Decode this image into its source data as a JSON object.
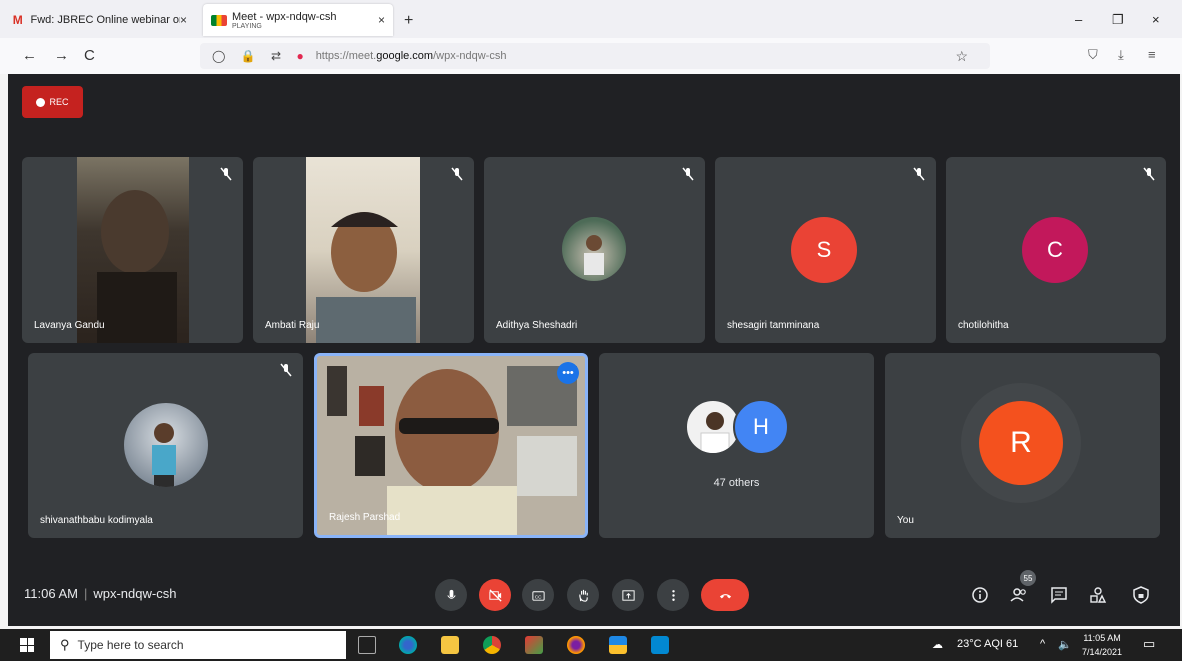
{
  "browser": {
    "tabs": [
      {
        "title": "Fwd: JBREC Online webinar on",
        "close": "×"
      },
      {
        "title": "Meet - wpx-ndqw-csh",
        "subtitle": "PLAYING",
        "close": "×"
      }
    ],
    "new_tab": "+",
    "window_controls": {
      "minimize": "–",
      "restore": "❐",
      "close": "×"
    },
    "nav": {
      "back": "←",
      "forward": "→",
      "reload": "C"
    },
    "url": {
      "prefix": "https://meet.",
      "domain": "google.com",
      "path": "/wpx-ndqw-csh"
    }
  },
  "meet": {
    "rec_label": "REC",
    "tiles_row1": [
      {
        "name": "Lavanya Gandu",
        "muted": true
      },
      {
        "name": "Ambati Raju",
        "muted": true
      },
      {
        "name": "Adithya Sheshadri",
        "muted": true
      },
      {
        "name": "shesagiri tamminana",
        "muted": true,
        "initial": "S",
        "color": "#ea4335"
      },
      {
        "name": "chotilohitha",
        "muted": true,
        "initial": "C",
        "color": "#c2185b"
      }
    ],
    "tiles_row2": [
      {
        "name": "shivanathbabu kodimyala",
        "muted": true
      },
      {
        "name": "Rajesh Parshad"
      },
      {
        "others_label": "47 others",
        "initial": "H",
        "color": "#4285f4"
      },
      {
        "name": "You",
        "initial": "R",
        "color": "#f4511e"
      }
    ],
    "bottom": {
      "time": "11:06 AM",
      "separator": "|",
      "meeting_code": "wpx-ndqw-csh",
      "people_count": "55"
    }
  },
  "taskbar": {
    "search_placeholder": "Type here to search",
    "weather": "23°C  AQI 61",
    "time": "11:05 AM",
    "date": "7/14/2021"
  },
  "colors": {
    "meet_bg": "#202124",
    "tile_bg": "#3c4043",
    "active_border": "#8ab4f8",
    "danger": "#ea4335"
  }
}
